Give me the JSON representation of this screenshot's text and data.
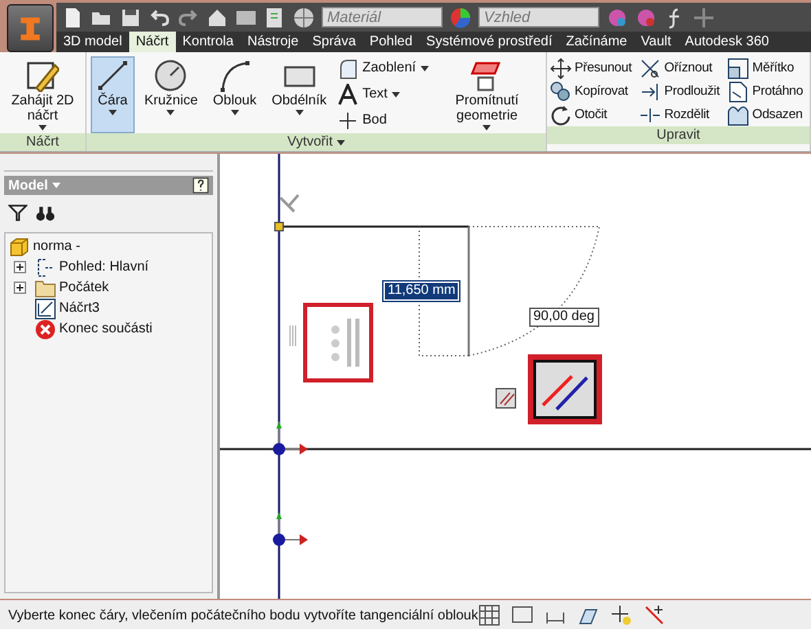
{
  "quick_access": {
    "material": {
      "placeholder": "Materiál"
    },
    "appearance": {
      "placeholder": "Vzhled"
    }
  },
  "tabs": [
    {
      "label": "3D model",
      "selected": false
    },
    {
      "label": "Náčrt",
      "selected": true
    },
    {
      "label": "Kontrola",
      "selected": false
    },
    {
      "label": "Nástroje",
      "selected": false
    },
    {
      "label": "Správa",
      "selected": false
    },
    {
      "label": "Pohled",
      "selected": false
    },
    {
      "label": "Systémové prostředí",
      "selected": false
    },
    {
      "label": "Začínáme",
      "selected": false
    },
    {
      "label": "Vault",
      "selected": false
    },
    {
      "label": "Autodesk 360",
      "selected": false
    }
  ],
  "ribbon": {
    "panels": [
      {
        "title": "Náčrt",
        "dropdown": false,
        "tools": [
          {
            "kind": "large",
            "label": "Zahájit 2D náčrt",
            "dropdown": true,
            "selected": false
          }
        ]
      },
      {
        "title": "Vytvořit",
        "dropdown": true,
        "tools": [
          {
            "kind": "large",
            "label": "Čára",
            "dropdown": true,
            "selected": true
          },
          {
            "kind": "large",
            "label": "Kružnice",
            "dropdown": true,
            "selected": false
          },
          {
            "kind": "large",
            "label": "Oblouk",
            "dropdown": true,
            "selected": false
          },
          {
            "kind": "large",
            "label": "Obdélník",
            "dropdown": true,
            "selected": false
          },
          {
            "kind": "small",
            "label": "Zaoblení",
            "dropdown": true
          },
          {
            "kind": "small",
            "label": "Text",
            "dropdown": true
          },
          {
            "kind": "small",
            "label": "Bod",
            "dropdown": false
          },
          {
            "kind": "large",
            "label": "Promítnutí geometrie",
            "dropdown": true,
            "selected": false
          }
        ]
      },
      {
        "title": "Upravit",
        "dropdown": false,
        "tools": [
          {
            "kind": "small",
            "label": "Přesunout"
          },
          {
            "kind": "small",
            "label": "Kopírovat"
          },
          {
            "kind": "small",
            "label": "Otočit"
          },
          {
            "kind": "small",
            "label": "Oříznout"
          },
          {
            "kind": "small",
            "label": "Prodloužit"
          },
          {
            "kind": "small",
            "label": "Rozdělit"
          },
          {
            "kind": "small",
            "label": "Měřítko"
          },
          {
            "kind": "small",
            "label": "Protáhno"
          },
          {
            "kind": "small",
            "label": "Odsazen"
          }
        ]
      }
    ]
  },
  "browser": {
    "title": "Model",
    "tree": [
      {
        "label": "norma -",
        "kind": "part",
        "children": [
          {
            "label": "Pohled: Hlavní",
            "kind": "view",
            "expanded": false
          },
          {
            "label": "Počátek",
            "kind": "folder",
            "expanded": false
          },
          {
            "label": "Náčrt3",
            "kind": "sketch"
          },
          {
            "label": "Konec součásti",
            "kind": "end"
          }
        ]
      }
    ]
  },
  "canvas": {
    "length_input": "11,650 mm",
    "angle_label": "90,00 deg"
  },
  "status_bar": {
    "message": "Vyberte konec čáry, vlečením počátečního bodu vytvoříte tangenciální oblouk"
  }
}
